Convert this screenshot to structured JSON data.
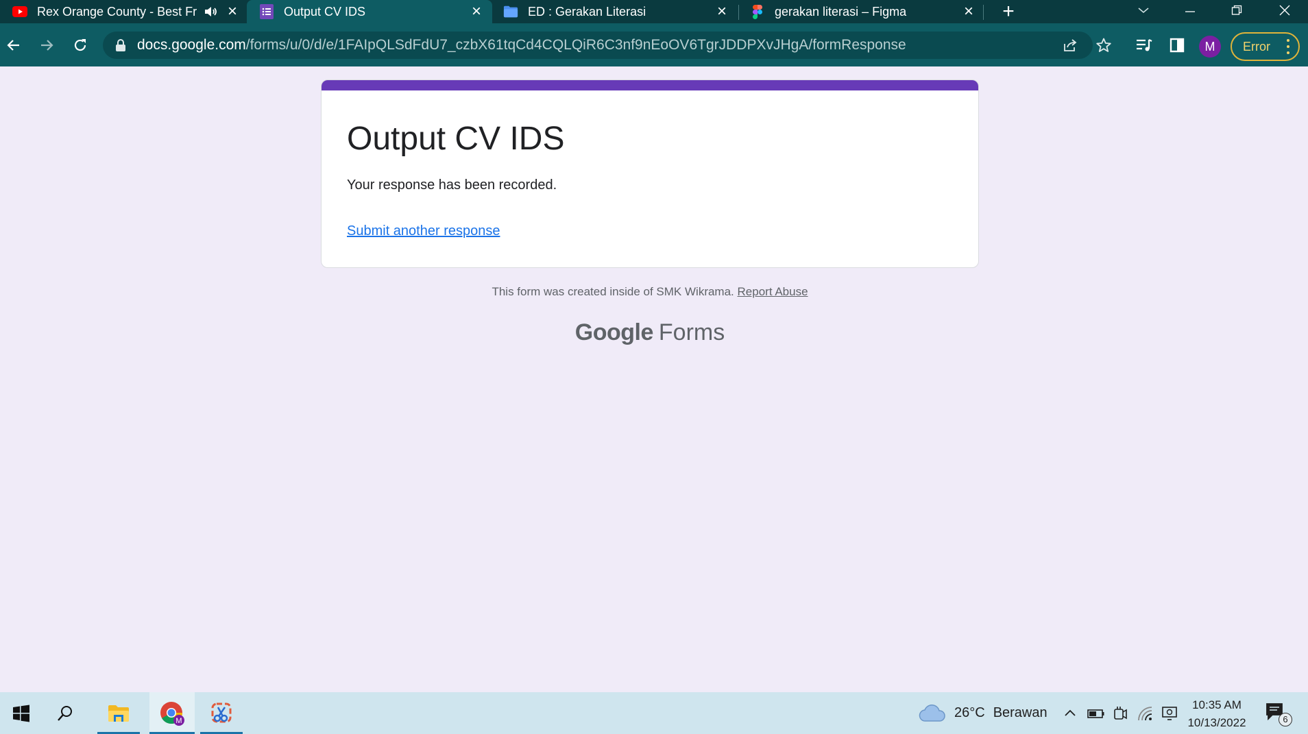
{
  "browser": {
    "tabs": [
      {
        "title": "Rex Orange County - Best Fri",
        "icon": "youtube-icon",
        "active": false,
        "audio": true
      },
      {
        "title": "Output CV IDS",
        "icon": "google-forms-icon",
        "active": true
      },
      {
        "title": "ED : Gerakan Literasi",
        "icon": "folder-icon",
        "active": false
      },
      {
        "title": "gerakan literasi – Figma",
        "icon": "figma-icon",
        "active": false
      }
    ],
    "url_domain": "docs.google.com",
    "url_path": "/forms/u/0/d/e/1FAIpQLSdFdU7_czbX61tqCd4CQLQiR6C3nf9nEoOV6TgrJDDPXvJHgA/formResponse",
    "profile_initial": "M",
    "error_label": "Error"
  },
  "form": {
    "title": "Output CV IDS",
    "message": "Your response has been recorded.",
    "another_link": "Submit another response",
    "footer_text": "This form was created inside of SMK Wikrama.",
    "report_link": "Report Abuse",
    "brand_google": "Google",
    "brand_forms": "Forms"
  },
  "taskbar": {
    "weather_temp": "26°C",
    "weather_desc": "Berawan",
    "time": "10:35 AM",
    "date": "10/13/2022",
    "notification_count": "6"
  },
  "colors": {
    "chrome_dark": "#0a3a3f",
    "chrome_toolbar": "#0e5c63",
    "forms_purple": "#673ab7",
    "page_bg": "#f0ebf8",
    "link_blue": "#1a73e8"
  }
}
